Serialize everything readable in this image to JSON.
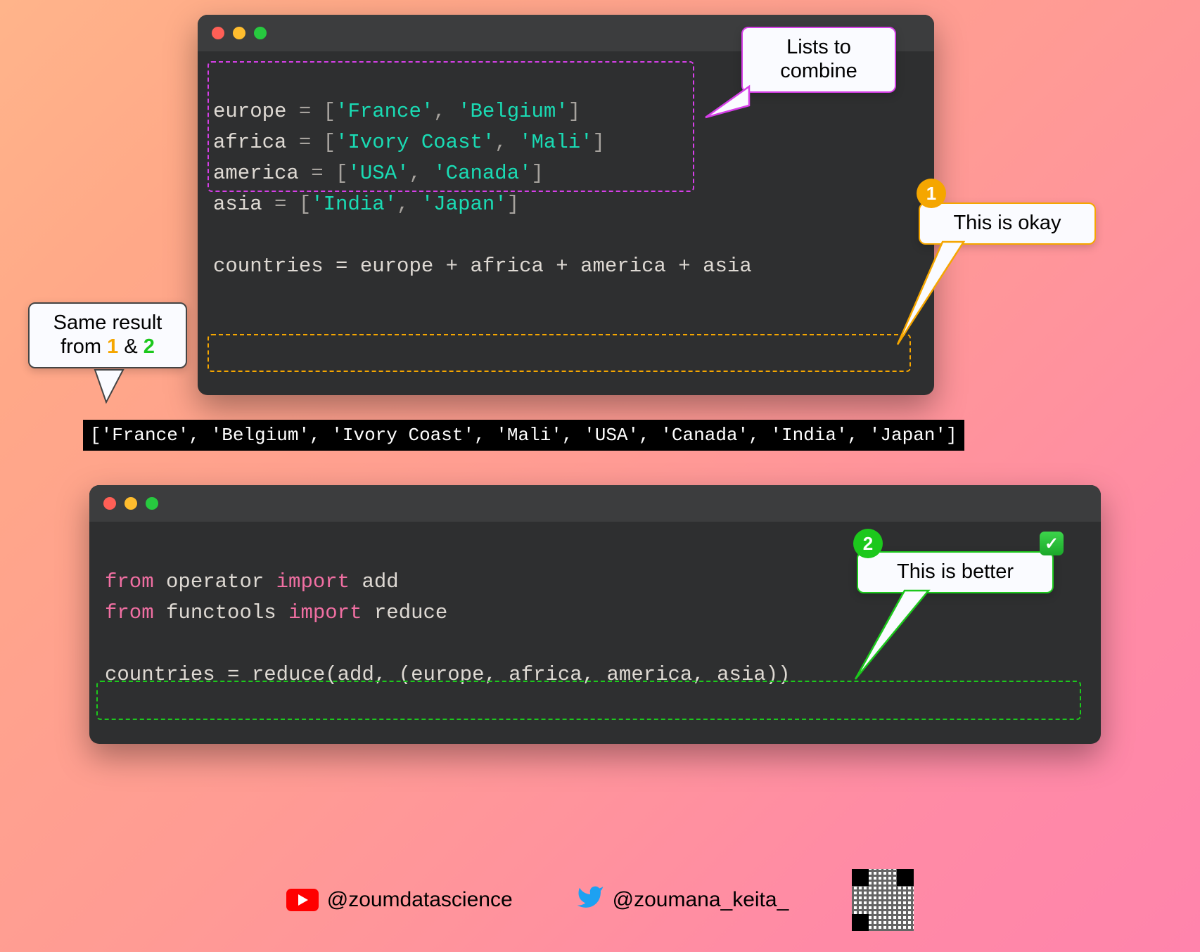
{
  "callouts": {
    "lists": "Lists to\ncombine",
    "okay": "This is okay",
    "better": "This is better",
    "same_prefix": "Same result\nfrom ",
    "same_amp": " & "
  },
  "badges": {
    "one": "1",
    "two": "2"
  },
  "code1": {
    "l1_a": "europe ",
    "l1_b": "= [",
    "l1_c": "'France'",
    "l1_d": ", ",
    "l1_e": "'Belgium'",
    "l1_f": "]",
    "l2_a": "africa ",
    "l2_b": "= [",
    "l2_c": "'Ivory Coast'",
    "l2_d": ", ",
    "l2_e": "'Mali'",
    "l2_f": "]",
    "l3_a": "america ",
    "l3_b": "= [",
    "l3_c": "'USA'",
    "l3_d": ", ",
    "l3_e": "'Canada'",
    "l3_f": "]",
    "l4_a": "asia ",
    "l4_b": "= [",
    "l4_c": "'India'",
    "l4_d": ", ",
    "l4_e": "'Japan'",
    "l4_f": "]",
    "l6": "countries = europe + africa + america + asia"
  },
  "output": "['France', 'Belgium', 'Ivory Coast', 'Mali', 'USA', 'Canada', 'India', 'Japan']",
  "code2": {
    "l1_a": "from",
    "l1_b": " operator ",
    "l1_c": "import",
    "l1_d": " add",
    "l2_a": "from",
    "l2_b": " functools ",
    "l2_c": "import",
    "l2_d": " reduce",
    "l4": "countries = reduce(add, (europe, africa, america, asia))"
  },
  "social": {
    "yt": "@zoumdatascience",
    "tw": "@zoumana_keita_"
  },
  "colors": {
    "magenta_dash": "#d63fe8",
    "orange_dash": "#f5a600",
    "green_dash": "#1cc81c",
    "badge1": "#f5a600",
    "badge2": "#1cc81c"
  }
}
